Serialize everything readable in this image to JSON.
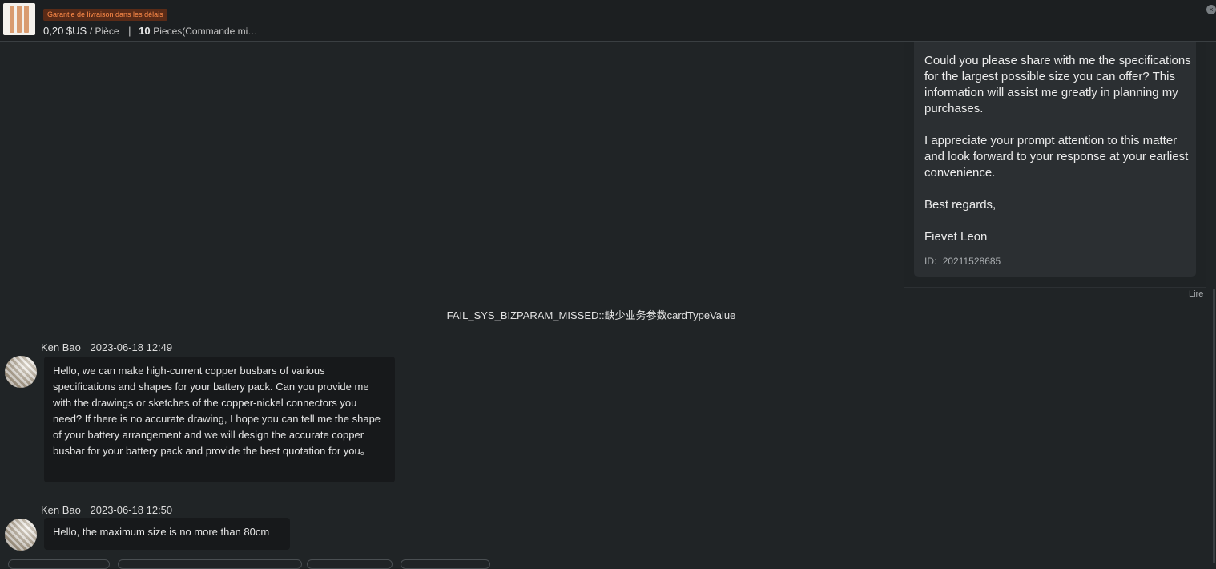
{
  "header": {
    "badge": "Garantie de livraison dans les délais",
    "price": "0,20 $US",
    "unit": "/ Pièce",
    "separator": "|",
    "quantity": "10",
    "pieces": "Pieces(Commande mi…",
    "close_glyph": "×"
  },
  "own_message": {
    "paragraphs": [
      "Could you please share with me the specifications for the largest possible size you can offer? This information will assist me greatly in planning my purchases.",
      "I appreciate your prompt attention to this matter and look forward to your response at your earliest convenience.",
      "Best regards,",
      "Fievet Leon"
    ],
    "id_label": "ID:",
    "id_value": "20211528685",
    "status": "Lire"
  },
  "system_line": "FAIL_SYS_BIZPARAM_MISSED::缺少业务参数cardTypeValue",
  "messages": [
    {
      "sender": "Ken Bao",
      "time": "2023-06-18 12:49",
      "text": "Hello, we can make high-current copper busbars of various specifications and shapes for your battery pack. Can you provide me with the drawings or sketches of the copper-nickel connectors you need? If there is no accurate drawing, I hope you can tell me the shape of your battery arrangement and we will design the accurate copper busbar for your battery pack and provide the best quotation for you。"
    },
    {
      "sender": "Ken Bao",
      "time": "2023-06-18 12:50",
      "text": "Hello, the maximum size is no more than 80cm"
    }
  ],
  "icons": {
    "close": "close-icon",
    "product": "product-thumbnail",
    "avatar": "avatar"
  }
}
